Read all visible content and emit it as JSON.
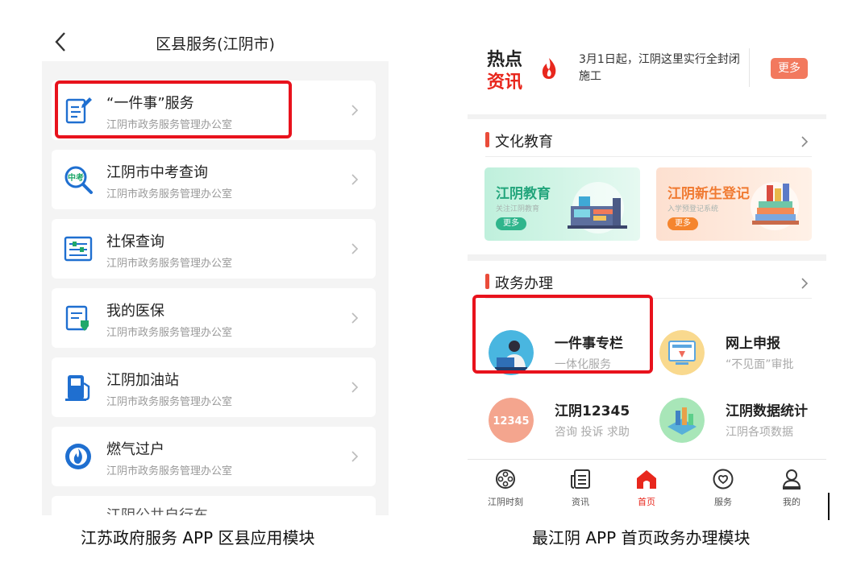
{
  "left_screen": {
    "header": {
      "title": "区县服务(江阴市)",
      "back_icon": "chevron-left-icon"
    },
    "services": [
      {
        "name": "“一件事”服务",
        "org": "江阴市政务服务管理办公室",
        "icon": "document-edit-icon"
      },
      {
        "name": "江阴市中考查询",
        "org": "江阴市政务服务管理办公室",
        "icon": "exam-search-icon"
      },
      {
        "name": "社保查询",
        "org": "江阴市政务服务管理办公室",
        "icon": "form-list-icon"
      },
      {
        "name": "我的医保",
        "org": "江阴市政务服务管理办公室",
        "icon": "medical-insurance-icon"
      },
      {
        "name": "江阴加油站",
        "org": "江阴市政务服务管理办公室",
        "icon": "gas-station-icon"
      },
      {
        "name": "燃气过户",
        "org": "江阴市政务服务管理办公室",
        "icon": "gas-flame-icon"
      },
      {
        "name": "江阴公共自行车",
        "org": "",
        "icon": ""
      }
    ]
  },
  "right_screen": {
    "hot_news": {
      "logo_line1": "热点",
      "logo_line2": "资讯",
      "headline": "3月1日起，江阴这里实行全封闭施工",
      "more_label": "更多"
    },
    "culture": {
      "title": "文化教育",
      "banners": [
        {
          "title": "江阴教育",
          "subtitle": "关注江阴教育",
          "more_label": "更多"
        },
        {
          "title": "江阴新生登记",
          "subtitle": "入学预登记系统",
          "more_label": "更多"
        }
      ]
    },
    "gov": {
      "title": "政务办理",
      "tiles": [
        {
          "name": "一件事专栏",
          "sub": "一体化服务"
        },
        {
          "name": "网上申报",
          "sub": "“不见面”审批"
        },
        {
          "name": "江阴12345",
          "sub": "咨询 投诉 求助",
          "icon_text": "12345"
        },
        {
          "name": "江阴数据统计",
          "sub": "江阴各项数据"
        }
      ]
    },
    "tabs": [
      {
        "label": "江阴时刻",
        "icon": "film-reel-icon",
        "active": false
      },
      {
        "label": "资讯",
        "icon": "news-icon",
        "active": false
      },
      {
        "label": "首页",
        "icon": "home-icon",
        "active": true
      },
      {
        "label": "服务",
        "icon": "heart-service-icon",
        "active": false
      },
      {
        "label": "我的",
        "icon": "user-icon",
        "active": false
      }
    ]
  },
  "captions": {
    "left": "江苏政府服务 APP 区县应用模块",
    "right": "最江阴 APP 首页政务办理模块"
  },
  "colors": {
    "highlight": "#e8121c",
    "brand_red": "#e8271d",
    "icon_blue": "#1f6fd0"
  }
}
